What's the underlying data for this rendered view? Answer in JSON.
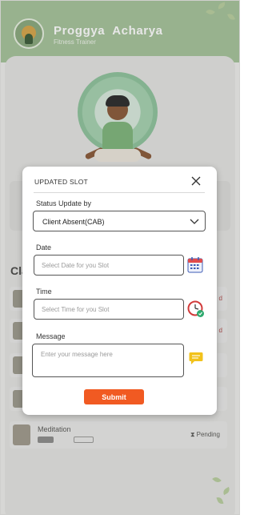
{
  "header": {
    "name": "Proggya  Acharya",
    "role": "Fitness Trainer"
  },
  "background": {
    "section_title_fragment": "Cla",
    "meditation": {
      "name": "Meditation",
      "status": "Pending"
    }
  },
  "modal": {
    "title": "UPDATED SLOT",
    "status_label": "Status Update by",
    "status_value": "Client Absent(CAB)",
    "date_label": "Date",
    "date_placeholder": "Select Date for you Slot",
    "time_label": "Time",
    "time_placeholder": "Select Time for you Slot",
    "message_label": "Message",
    "message_placeholder": "Enter your message here",
    "submit_label": "Submit"
  },
  "colors": {
    "header_bg": "#a6c39a",
    "accent": "#f15a22",
    "calendar_icon": "#3c5bb4",
    "clock_icon": "#d23a3a",
    "message_icon": "#f2c21b"
  },
  "icons": [
    "calendar-icon",
    "clock-icon",
    "message-icon",
    "close-icon",
    "chevron-down-icon",
    "hourglass-icon"
  ]
}
